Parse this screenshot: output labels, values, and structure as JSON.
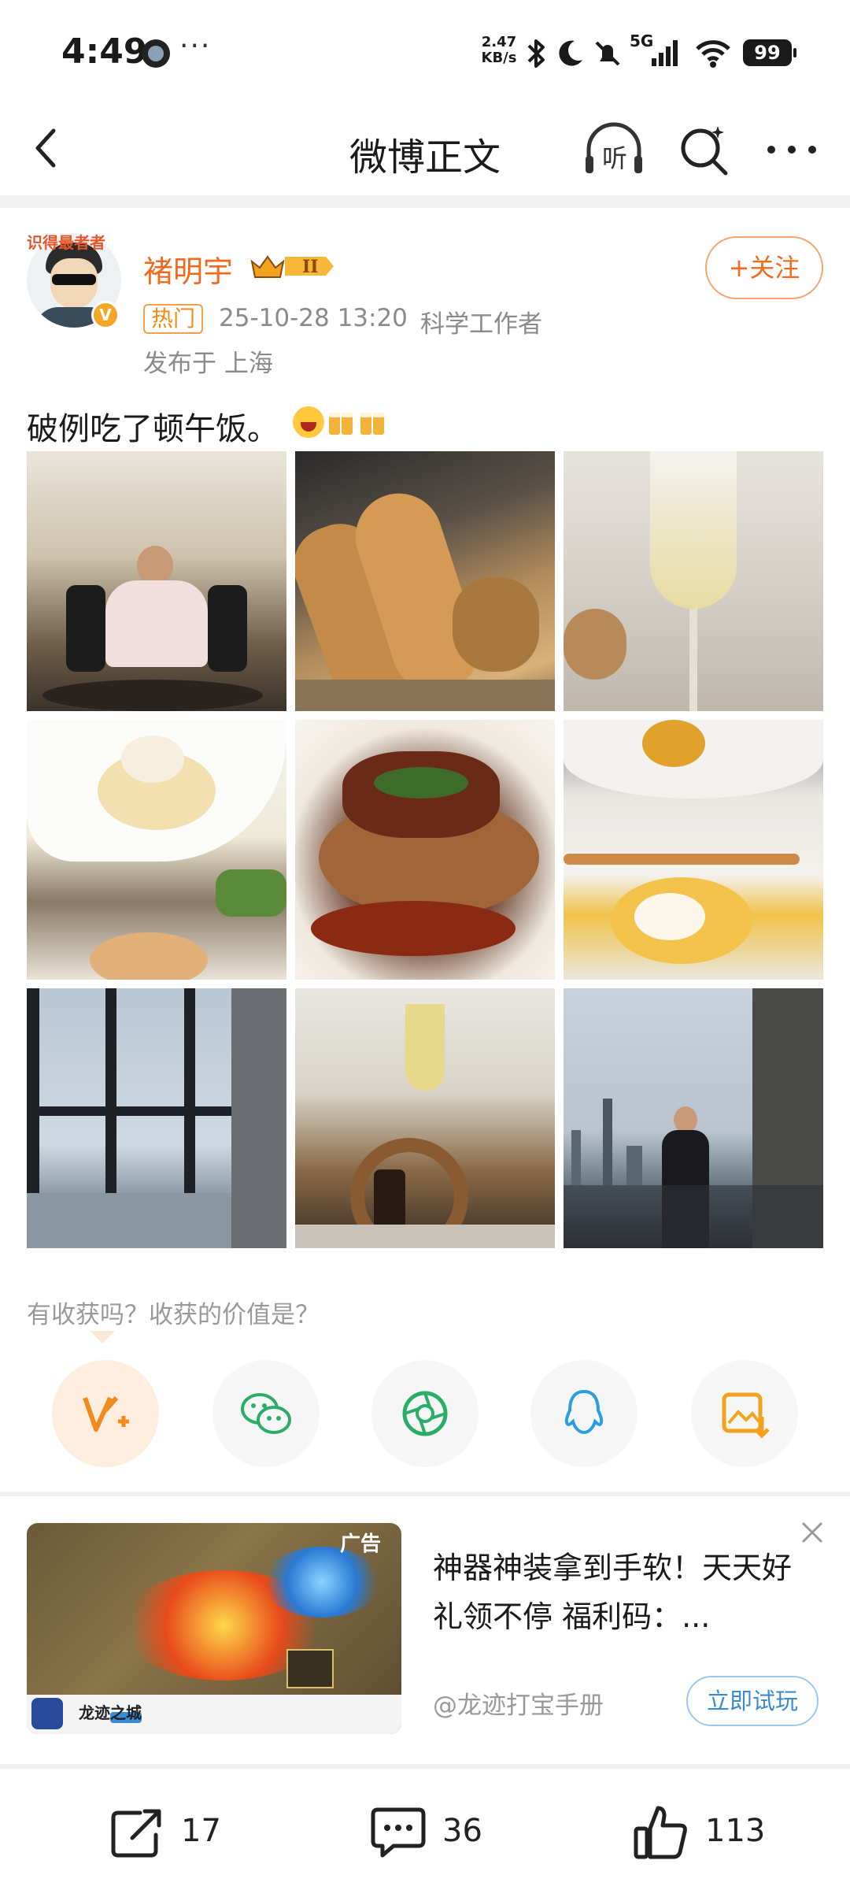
{
  "status_bar": {
    "time": "4:49",
    "dots": "···",
    "net_speed_value": "2.47",
    "net_speed_unit": "KB/s",
    "network": "5G",
    "battery": "99"
  },
  "nav": {
    "title": "微博正文",
    "listen_label": "听"
  },
  "author": {
    "name": "褚明宇",
    "avatar_ribbon": "识得最者者"
  },
  "follow_label": "+关注",
  "meta": {
    "hot_tag": "热门",
    "time": "25-10-28 13:20",
    "source": "科学工作者",
    "location": "发布于 上海"
  },
  "post": {
    "text": "破例吃了顿午饭。"
  },
  "photos": [
    {
      "name": "photo-man-in-restaurant"
    },
    {
      "name": "photo-bread"
    },
    {
      "name": "photo-champagne-glass"
    },
    {
      "name": "photo-eggs-benedict"
    },
    {
      "name": "photo-meat-dish"
    },
    {
      "name": "photo-dessert"
    },
    {
      "name": "photo-window-view"
    },
    {
      "name": "photo-champagne-bottle"
    },
    {
      "name": "photo-man-on-terrace"
    }
  ],
  "prompt": "有收获吗？收获的价值是？",
  "share": [
    {
      "icon": "value-plus-icon",
      "color": "#f28a1d"
    },
    {
      "icon": "wechat-icon",
      "color": "#2aae67"
    },
    {
      "icon": "moments-icon",
      "color": "#2aae67"
    },
    {
      "icon": "qq-icon",
      "color": "#2a9ee0"
    },
    {
      "icon": "save-image-icon",
      "color": "#f2a21d"
    }
  ],
  "ad": {
    "label": "广告",
    "title": "神器神装拿到手软！天天好礼领不停 福利码：...",
    "source": "@龙迹打宝手册",
    "cta": "立即试玩",
    "game_name": "龙迹之城"
  },
  "bottom_bar": {
    "repost_count": "17",
    "comment_count": "36",
    "like_count": "113"
  },
  "colors": {
    "brand_orange": "#f26b1d",
    "meta_gray": "#8a8a8a",
    "cta_blue": "#3a8bd6"
  }
}
